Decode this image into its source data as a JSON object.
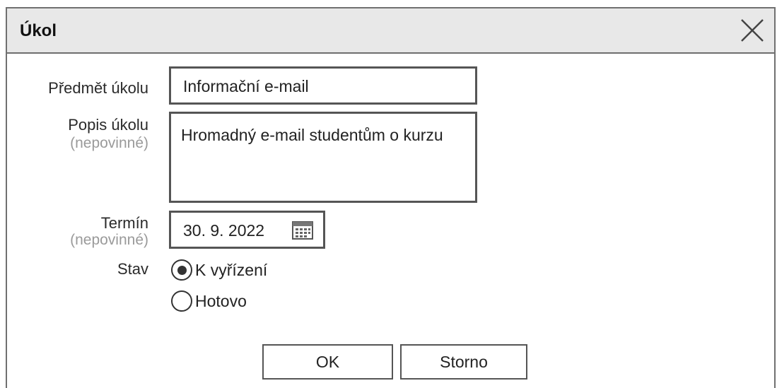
{
  "dialog": {
    "title": "Úkol"
  },
  "form": {
    "subject": {
      "label": "Předmět úkolu",
      "value": "Informační e-mail"
    },
    "description": {
      "label": "Popis úkolu",
      "optional": "(nepovinné)",
      "value": "Hromadný e-mail studentům o kurzu"
    },
    "due": {
      "label": "Termín",
      "optional": "(nepovinné)",
      "value": "30. 9. 2022"
    },
    "status": {
      "label": "Stav",
      "options": [
        {
          "label": "K vyřízení",
          "selected": true
        },
        {
          "label": "Hotovo",
          "selected": false
        }
      ]
    }
  },
  "buttons": {
    "ok": "OK",
    "cancel": "Storno"
  },
  "icons": {
    "close": "close-icon",
    "calendar": "calendar-icon"
  }
}
